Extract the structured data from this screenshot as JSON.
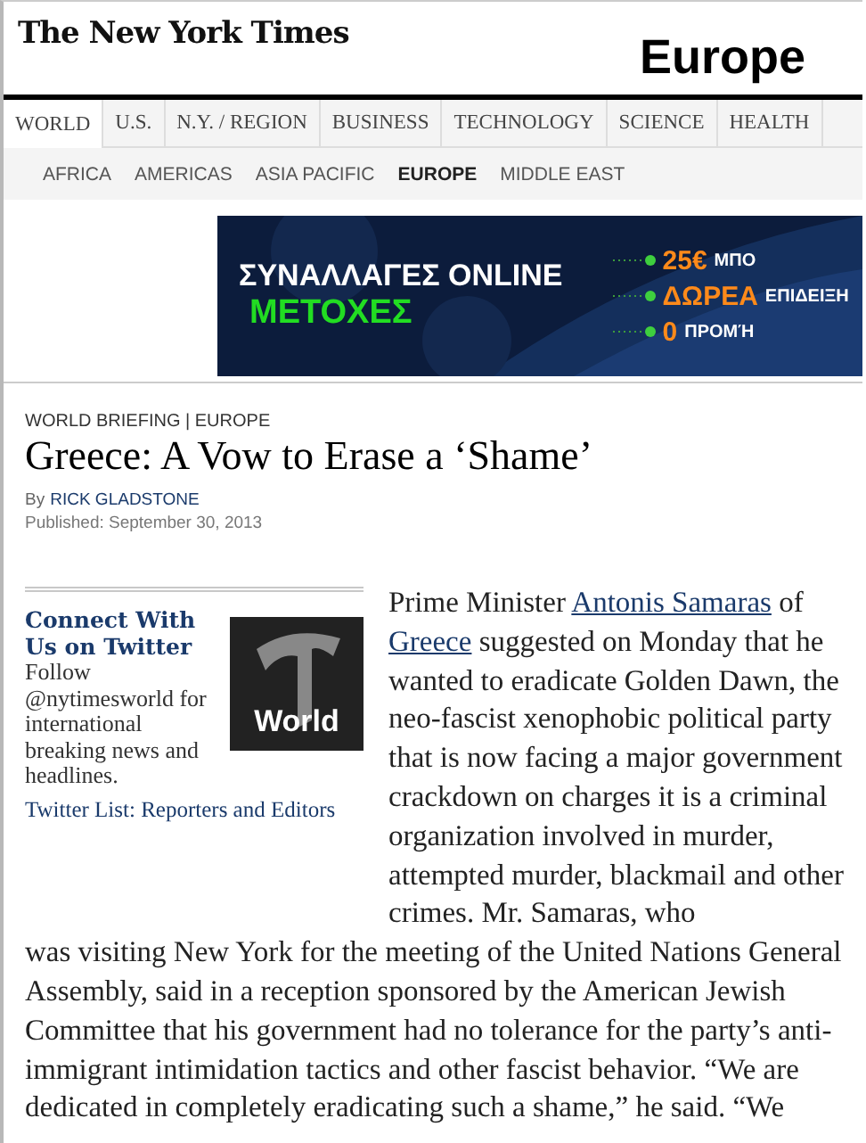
{
  "masthead": {
    "logo": "The New York Times",
    "section": "Europe"
  },
  "nav": [
    {
      "label": "WORLD",
      "selected": true
    },
    {
      "label": "U.S.",
      "selected": false
    },
    {
      "label": "N.Y. / REGION",
      "selected": false
    },
    {
      "label": "BUSINESS",
      "selected": false
    },
    {
      "label": "TECHNOLOGY",
      "selected": false
    },
    {
      "label": "SCIENCE",
      "selected": false
    },
    {
      "label": "HEALTH",
      "selected": false
    }
  ],
  "subnav": [
    {
      "label": "AFRICA",
      "selected": false
    },
    {
      "label": "AMERICAS",
      "selected": false
    },
    {
      "label": "ASIA PACIFIC",
      "selected": false
    },
    {
      "label": "EUROPE",
      "selected": true
    },
    {
      "label": "MIDDLE EAST",
      "selected": false
    }
  ],
  "ad": {
    "headline": "ΣΥΝΑΛΛΑΓΕΣ ONLINE",
    "subheadline": "ΜΕΤΟΧΕΣ",
    "offers": [
      {
        "highlight": "25€",
        "text": "ΜΠΟ"
      },
      {
        "highlight": "ΔΩΡΕΑ",
        "text": "ΕΠΙΔΕΙΞΗ"
      },
      {
        "highlight": "0",
        "text": "ΠΡΟΜΉ"
      }
    ]
  },
  "article": {
    "kicker": "WORLD BRIEFING | EUROPE",
    "headline": "Greece: A Vow to Erase a ‘Shame’",
    "byline_prefix": "By",
    "author": "RICK GLADSTONE",
    "published": "Published: September 30, 2013",
    "sidebar": {
      "title": "Connect With Us on Twitter",
      "text": "Follow @nytimesworld for international breaking news and headlines.",
      "link": "Twitter List: Reporters and Editors",
      "thumbnail_label": "World"
    },
    "body": [
      {
        "text": "Prime Minister ",
        "link": false
      },
      {
        "text": "Antonis Samaras",
        "link": true
      },
      {
        "text": " of ",
        "link": false
      },
      {
        "text": "Greece",
        "link": true
      },
      {
        "text": " suggested on Monday that he wanted to eradicate Golden Dawn, the neo-fascist xenophobic political party that is now facing a major government crackdown on charges it is a criminal organization involved in murder, attempted murder, blackmail and other crimes. Mr. Samaras, who",
        "link": false
      }
    ],
    "body_continued": "was visiting New York for the meeting of the United Nations General Assembly, said in a reception sponsored by the American Jewish Committee that his government had no tolerance for the party’s anti-immigrant intimidation tactics and other fascist behavior. “We are dedicated in completely eradicating such a shame,” he said. “We"
  }
}
